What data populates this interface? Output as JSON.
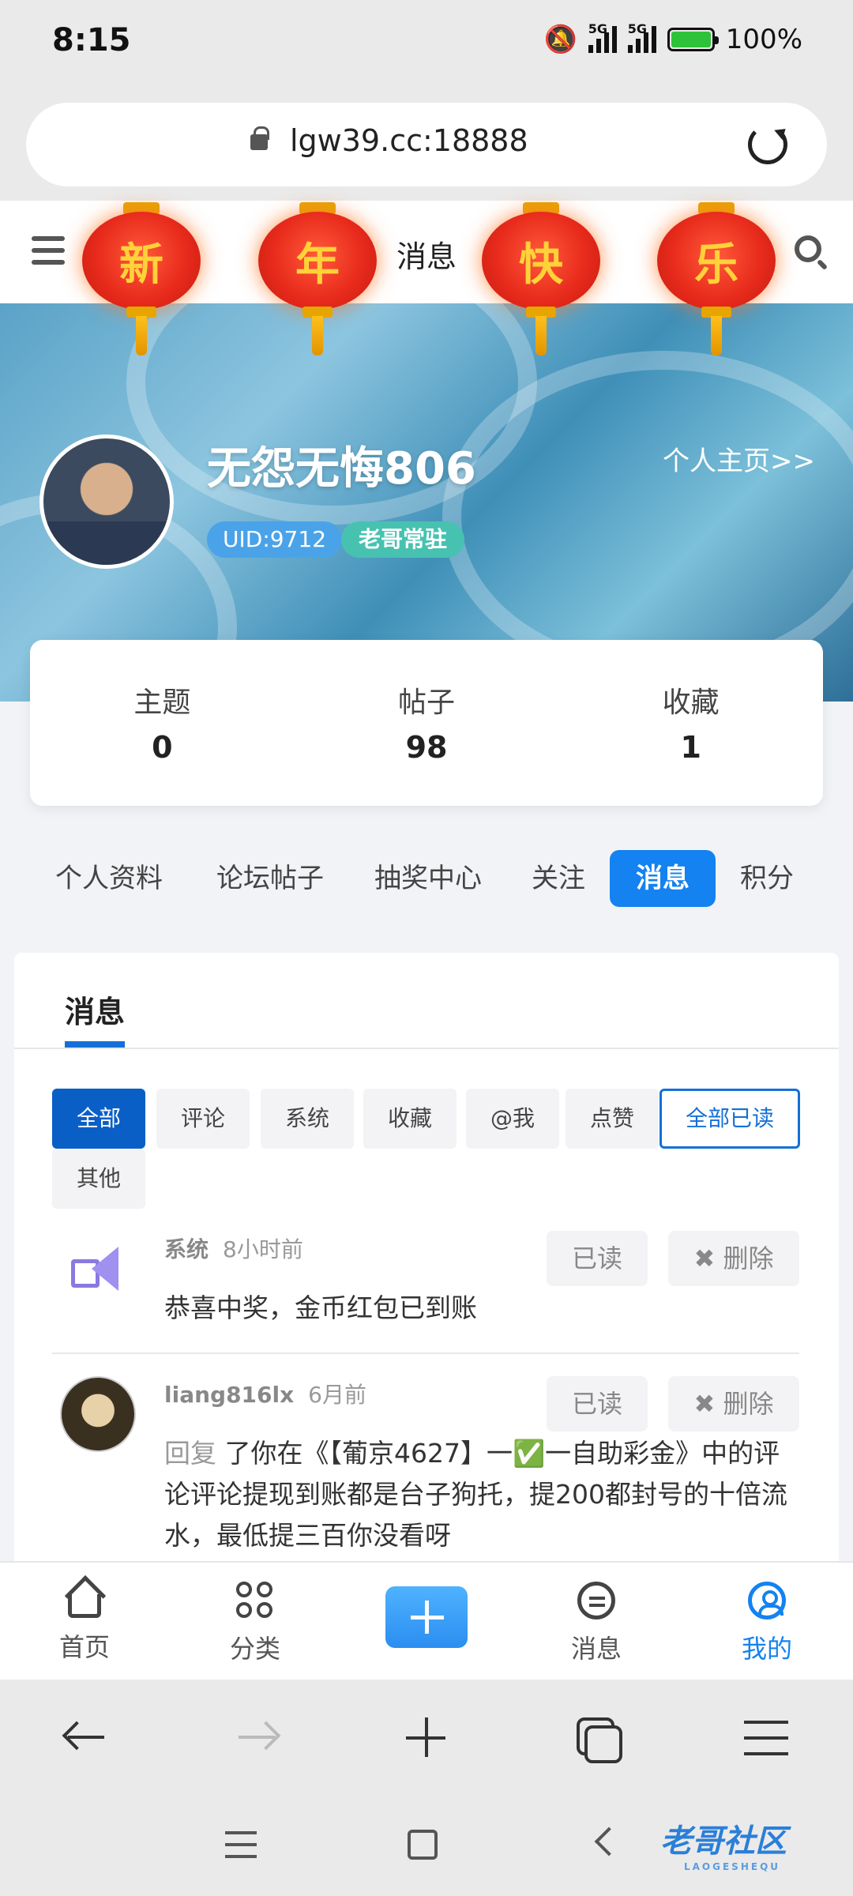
{
  "status_bar": {
    "time": "8:15",
    "network": "5G",
    "battery": "100%"
  },
  "browser": {
    "url": "lgw39.cc:18888"
  },
  "header": {
    "title": "消息",
    "lanterns": [
      "新",
      "年",
      "快",
      "乐"
    ]
  },
  "profile": {
    "username": "无怨无悔806",
    "homepage_link": "个人主页>>",
    "uid": "UID:9712",
    "role": "老哥常驻"
  },
  "stats": [
    {
      "label": "主题",
      "value": "0"
    },
    {
      "label": "帖子",
      "value": "98"
    },
    {
      "label": "收藏",
      "value": "1"
    }
  ],
  "tabs": [
    {
      "label": "个人资料"
    },
    {
      "label": "论坛帖子"
    },
    {
      "label": "抽奖中心"
    },
    {
      "label": "关注"
    },
    {
      "label": "消息",
      "active": true
    },
    {
      "label": "积分"
    }
  ],
  "messages_section": {
    "title": "消息",
    "filters": [
      {
        "label": "全部",
        "active": true
      },
      {
        "label": "评论"
      },
      {
        "label": "系统"
      },
      {
        "label": "收藏"
      },
      {
        "label": "@我"
      },
      {
        "label": "点赞"
      },
      {
        "label": "全部已读"
      },
      {
        "label": "其他"
      }
    ],
    "items": [
      {
        "icon": "megaphone-icon",
        "sender": "系统",
        "time": "8小时前",
        "read_label": "已读",
        "delete_label": "删除",
        "text": "恭喜中奖，金币红包已到账"
      },
      {
        "icon": "user-avatar",
        "sender": "liang816lx",
        "time": "6月前",
        "read_label": "已读",
        "delete_label": "删除",
        "reply_prefix": "回复",
        "text": "了你在《【葡京4627】一✅一自助彩金》中的评论评论提现到账都是台子狗托，提200都封号的十倍流水，最低提三百你没看呀"
      }
    ]
  },
  "bottom_nav": [
    {
      "label": "首页",
      "icon": "home-icon"
    },
    {
      "label": "分类",
      "icon": "grid-icon"
    },
    {
      "label": "",
      "icon": "plus-icon"
    },
    {
      "label": "消息",
      "icon": "chat-icon"
    },
    {
      "label": "我的",
      "icon": "user-icon",
      "active": true
    }
  ],
  "watermark": {
    "text": "老哥社区",
    "sub": "LAOGESHEQU"
  },
  "colors": {
    "accent": "#1482f0",
    "active_filter": "#0a5fc7",
    "uid_badge": "#4aa3e8",
    "role_badge": "#47c2b0"
  }
}
